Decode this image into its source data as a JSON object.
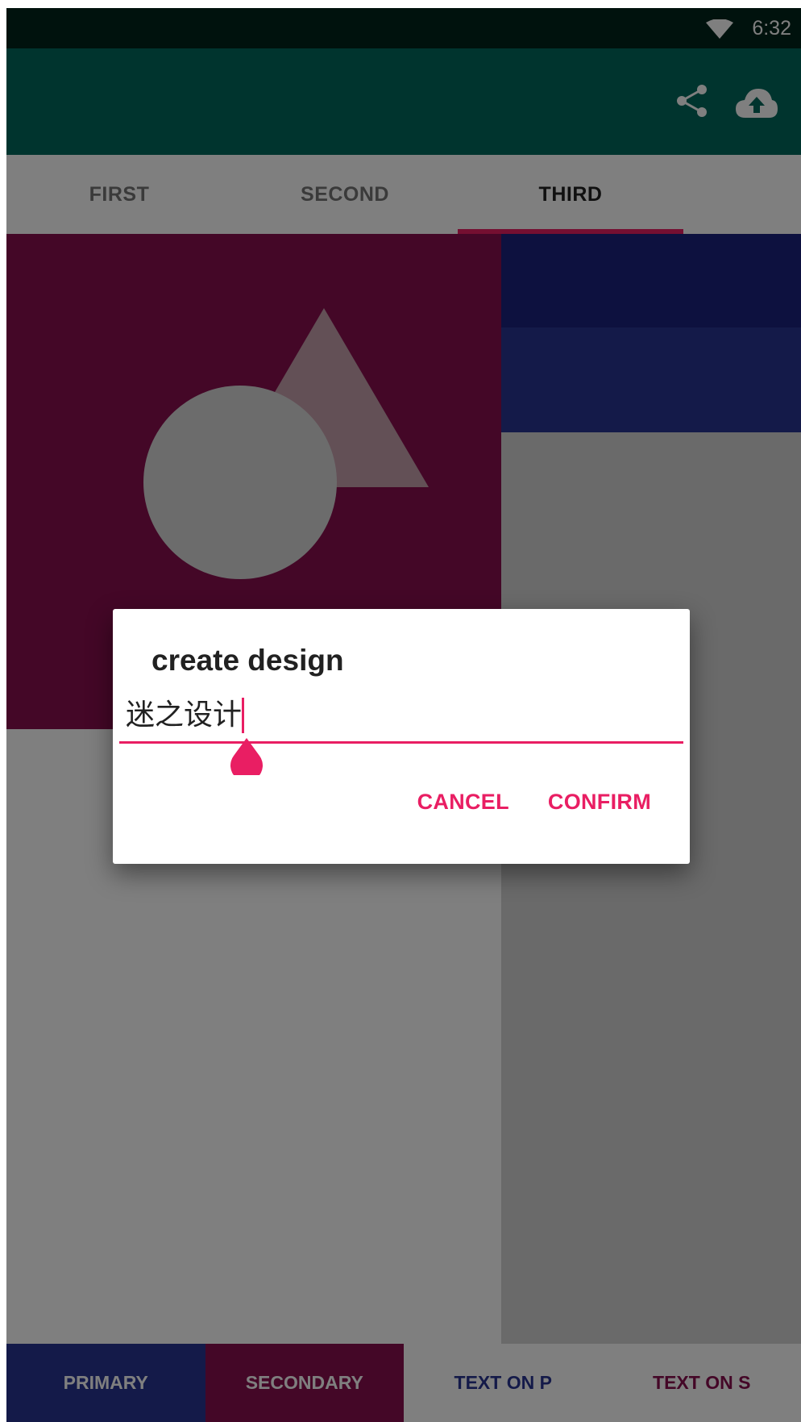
{
  "status_bar": {
    "time": "6:32",
    "wifi_icon": "wifi-icon"
  },
  "app_bar": {
    "actions": [
      {
        "icon": "share-icon"
      },
      {
        "icon": "cloud-upload-icon"
      }
    ],
    "color": "#00695c",
    "dark_color": "#00251a"
  },
  "tabs": {
    "items": [
      "FIRST",
      "SECOND",
      "THIRD"
    ],
    "selected": "THIRD",
    "indicator_color": "#e91e63"
  },
  "content": {
    "hero_color": "#880e4f",
    "primary_dark": "#1a237e",
    "primary": "#283593"
  },
  "dialog": {
    "title": "create design",
    "input_value": "迷之设计",
    "cancel_label": "CANCEL",
    "confirm_label": "CONFIRM",
    "accent_color": "#e91e63"
  },
  "bottom_nav": {
    "items": [
      {
        "label": "PRIMARY",
        "bg": "#283593",
        "fg": "#ffffff"
      },
      {
        "label": "SECONDARY",
        "bg": "#880e4f",
        "fg": "#ffffff"
      },
      {
        "label": "TEXT ON P",
        "bg": "#ffffff",
        "fg": "#283593"
      },
      {
        "label": "TEXT ON S",
        "bg": "#ffffff",
        "fg": "#880e4f"
      }
    ]
  }
}
